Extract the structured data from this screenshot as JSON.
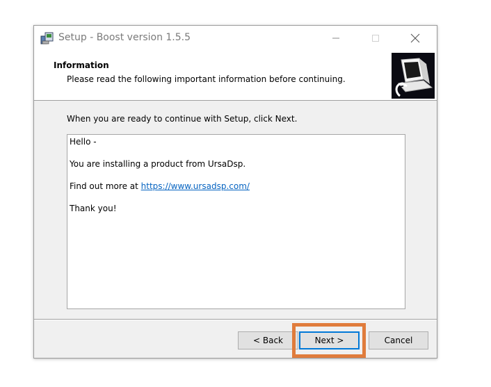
{
  "window": {
    "title": "Setup - Boost version 1.5.5"
  },
  "header": {
    "title": "Information",
    "subtitle": "Please read the following important information before continuing."
  },
  "main": {
    "instruction": "When you are ready to continue with Setup, click Next.",
    "info": {
      "line1": "Hello -",
      "line2": "You are installing a product from UrsaDsp.",
      "line3_prefix": "Find out more at ",
      "line3_link": "https://www.ursadsp.com/",
      "line4": "Thank you!"
    }
  },
  "buttons": {
    "back": "< Back",
    "next": "Next >",
    "cancel": "Cancel"
  },
  "colors": {
    "highlight": "#e07c3c",
    "link": "#0563c1",
    "default_button_border": "#0078d7"
  },
  "icons": {
    "app": "installer-icon",
    "wizard": "computer-install-icon"
  }
}
